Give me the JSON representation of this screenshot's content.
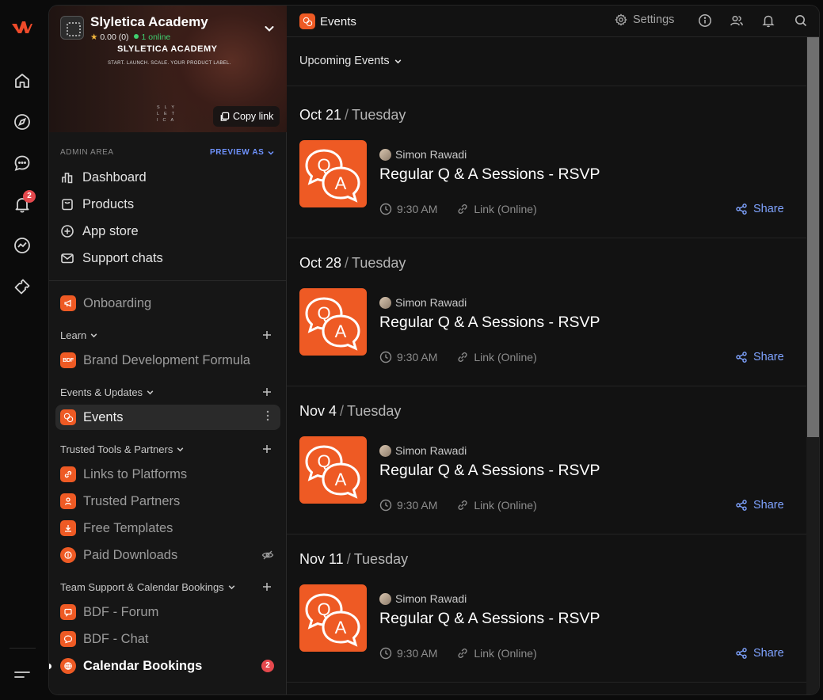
{
  "rail": {
    "icons": [
      "logo-icon",
      "home-icon",
      "compass-icon",
      "chat-icon",
      "bell-icon",
      "analytics-icon",
      "ticket-icon",
      "menu-icon"
    ],
    "notification_count": "2"
  },
  "sidebar": {
    "community_name": "Slyletica Academy",
    "rating": "0.00",
    "rating_count": "(0)",
    "online": "1 online",
    "banner_wordmark": "SLYLETICA ACADEMY",
    "banner_tagline": "START. LAUNCH. SCALE. YOUR PRODUCT LABEL.",
    "banner_monogram": "SLY LET ICA",
    "copy_link": "Copy link",
    "admin_label": "ADMIN AREA",
    "preview_as": "PREVIEW AS",
    "admin_items": [
      {
        "label": "Dashboard",
        "icon": "bar-chart-icon"
      },
      {
        "label": "Products",
        "icon": "bag-icon"
      },
      {
        "label": "App store",
        "icon": "plus-circle-icon"
      },
      {
        "label": "Support chats",
        "icon": "mail-icon"
      }
    ],
    "onboarding": "Onboarding",
    "sections": [
      {
        "title": "Learn",
        "items": [
          {
            "label": "Brand Development Formula",
            "icon_text": "BDF"
          }
        ]
      },
      {
        "title": "Events & Updates",
        "items": [
          {
            "label": "Events"
          }
        ]
      },
      {
        "title": "Trusted Tools & Partners",
        "items": [
          {
            "label": "Links to Platforms"
          },
          {
            "label": "Trusted Partners"
          },
          {
            "label": "Free Templates"
          },
          {
            "label": "Paid Downloads"
          }
        ]
      },
      {
        "title": "Team Support & Calendar Bookings",
        "items": [
          {
            "label": "BDF - Forum"
          },
          {
            "label": "BDF - Chat"
          },
          {
            "label": "Calendar Bookings",
            "count": "2"
          }
        ]
      }
    ]
  },
  "header": {
    "channel": "Events",
    "settings": "Settings"
  },
  "filter": "Upcoming Events",
  "events": [
    {
      "date": "Oct 21",
      "day": "Tuesday",
      "host": "Simon Rawadi",
      "title": "Regular Q & A Sessions - RSVP",
      "time": "9:30 AM",
      "location": "Link (Online)",
      "share": "Share"
    },
    {
      "date": "Oct 28",
      "day": "Tuesday",
      "host": "Simon Rawadi",
      "title": "Regular Q & A Sessions - RSVP",
      "time": "9:30 AM",
      "location": "Link (Online)",
      "share": "Share"
    },
    {
      "date": "Nov 4",
      "day": "Tuesday",
      "host": "Simon Rawadi",
      "title": "Regular Q & A Sessions - RSVP",
      "time": "9:30 AM",
      "location": "Link (Online)",
      "share": "Share"
    },
    {
      "date": "Nov 11",
      "day": "Tuesday",
      "host": "Simon Rawadi",
      "title": "Regular Q & A Sessions - RSVP",
      "time": "9:30 AM",
      "location": "Link (Online)",
      "share": "Share"
    }
  ],
  "colors": {
    "accent": "#ee5a24",
    "link": "#7fa3ff",
    "badge": "#e5484d",
    "online": "#3fcf6f"
  }
}
